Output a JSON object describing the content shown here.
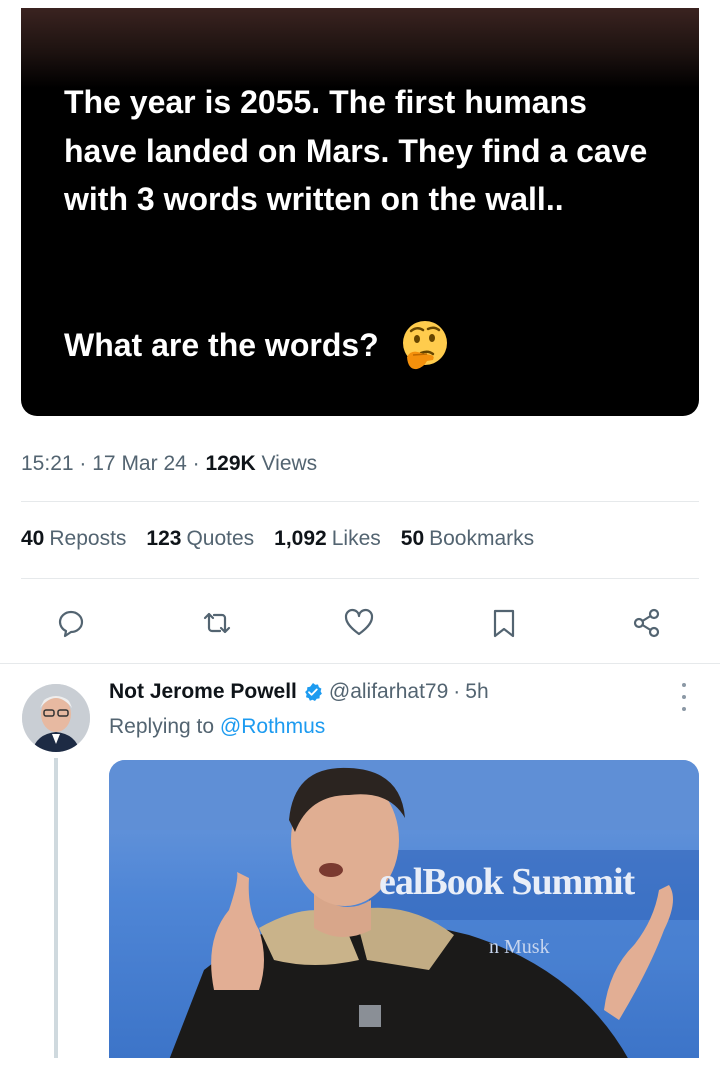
{
  "tweet": {
    "media_text": "The year is 2055. The first humans have landed on Mars. They find a cave with 3 words written on the wall..",
    "media_question": "What are the words?",
    "emoji": "thinking-face-emoji",
    "time": "15:21",
    "separator": "·",
    "date": "17 Mar 24",
    "views_count": "129K",
    "views_label": "Views"
  },
  "stats": [
    {
      "count": "40",
      "label": "Reposts"
    },
    {
      "count": "123",
      "label": "Quotes"
    },
    {
      "count": "1,092",
      "label": "Likes"
    },
    {
      "count": "50",
      "label": "Bookmarks"
    }
  ],
  "actions": [
    {
      "icon": "reply-icon"
    },
    {
      "icon": "repost-icon"
    },
    {
      "icon": "like-icon"
    },
    {
      "icon": "bookmark-icon"
    },
    {
      "icon": "share-icon"
    }
  ],
  "reply": {
    "name": "Not Jerome Powell",
    "handle": "@alifarhat79",
    "separator": "·",
    "time": "5h",
    "replying_label": "Replying to",
    "replying_to": "@Rothmus",
    "photo_banner": "ealBook Summit",
    "photo_sub": "n Musk"
  },
  "colors": {
    "text_primary": "#0f1419",
    "text_secondary": "#536471",
    "link": "#1d9bf0",
    "divider": "#e6e9eb"
  }
}
